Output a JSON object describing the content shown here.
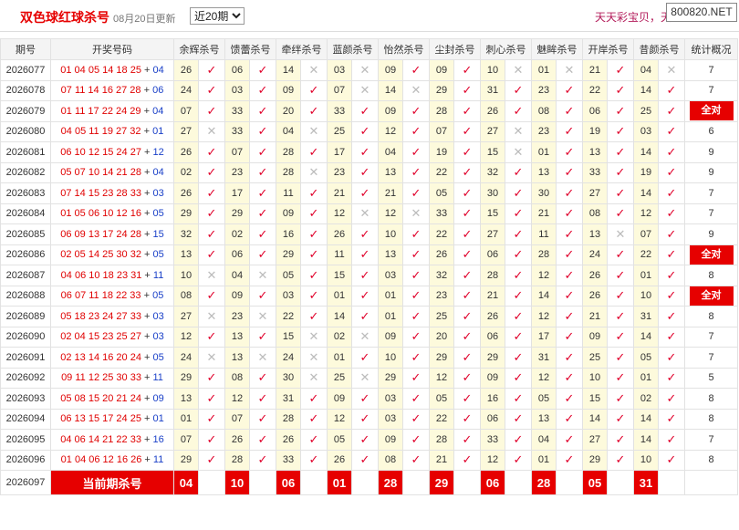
{
  "header": {
    "title": "双色球红球杀号",
    "update_text": "08月20日更新",
    "period_select": "近20期",
    "period_options": [
      "近20期"
    ],
    "slogan": "天天彩宝贝，天",
    "site_badge": "800820.NET"
  },
  "columns": [
    "期号",
    "开奖号码",
    "余辉杀号",
    "馈蕾杀号",
    "牵绊杀号",
    "蓝颜杀号",
    "怡然杀号",
    "尘封杀号",
    "刺心杀号",
    "魅眸杀号",
    "开岸杀号",
    "昔颜杀号",
    "统计概况"
  ],
  "rows": [
    {
      "period": "2026077",
      "reds": "01 04 05 14 18 25",
      "blue": "04",
      "kills": [
        [
          "26",
          "ok"
        ],
        [
          "06",
          "ok"
        ],
        [
          "14",
          "x"
        ],
        [
          "03",
          "x"
        ],
        [
          "09",
          "ok"
        ],
        [
          "09",
          "ok"
        ],
        [
          "10",
          "x"
        ],
        [
          "01",
          "x"
        ],
        [
          "21",
          "ok"
        ],
        [
          "04",
          "x"
        ]
      ],
      "stat": "7"
    },
    {
      "period": "2026078",
      "reds": "07 11 14 16 27 28",
      "blue": "06",
      "kills": [
        [
          "24",
          "ok"
        ],
        [
          "03",
          "ok"
        ],
        [
          "09",
          "ok"
        ],
        [
          "07",
          "x"
        ],
        [
          "14",
          "x"
        ],
        [
          "29",
          "ok"
        ],
        [
          "31",
          "ok"
        ],
        [
          "23",
          "ok"
        ],
        [
          "22",
          "ok"
        ],
        [
          "14",
          "ok"
        ]
      ],
      "stat": "7"
    },
    {
      "period": "2026079",
      "reds": "01 11 17 22 24 29",
      "blue": "04",
      "kills": [
        [
          "07",
          "ok"
        ],
        [
          "33",
          "ok"
        ],
        [
          "20",
          "ok"
        ],
        [
          "33",
          "ok"
        ],
        [
          "09",
          "ok"
        ],
        [
          "28",
          "ok"
        ],
        [
          "26",
          "ok"
        ],
        [
          "08",
          "ok"
        ],
        [
          "06",
          "ok"
        ],
        [
          "25",
          "ok"
        ]
      ],
      "stat": "全对"
    },
    {
      "period": "2026080",
      "reds": "04 05 11 19 27 32",
      "blue": "01",
      "kills": [
        [
          "27",
          "x"
        ],
        [
          "33",
          "ok"
        ],
        [
          "04",
          "x"
        ],
        [
          "25",
          "ok"
        ],
        [
          "12",
          "ok"
        ],
        [
          "07",
          "ok"
        ],
        [
          "27",
          "x"
        ],
        [
          "23",
          "ok"
        ],
        [
          "19",
          "ok"
        ],
        [
          "03",
          "ok"
        ]
      ],
      "stat": "6"
    },
    {
      "period": "2026081",
      "reds": "06 10 12 15 24 27",
      "blue": "12",
      "kills": [
        [
          "26",
          "ok"
        ],
        [
          "07",
          "ok"
        ],
        [
          "28",
          "ok"
        ],
        [
          "17",
          "ok"
        ],
        [
          "04",
          "ok"
        ],
        [
          "19",
          "ok"
        ],
        [
          "15",
          "x"
        ],
        [
          "01",
          "ok"
        ],
        [
          "13",
          "ok"
        ],
        [
          "14",
          "ok"
        ]
      ],
      "stat": "9"
    },
    {
      "period": "2026082",
      "reds": "05 07 10 14 21 28",
      "blue": "04",
      "kills": [
        [
          "02",
          "ok"
        ],
        [
          "23",
          "ok"
        ],
        [
          "28",
          "x"
        ],
        [
          "23",
          "ok"
        ],
        [
          "13",
          "ok"
        ],
        [
          "22",
          "ok"
        ],
        [
          "32",
          "ok"
        ],
        [
          "13",
          "ok"
        ],
        [
          "33",
          "ok"
        ],
        [
          "19",
          "ok"
        ]
      ],
      "stat": "9"
    },
    {
      "period": "2026083",
      "reds": "07 14 15 23 28 33",
      "blue": "03",
      "kills": [
        [
          "26",
          "ok"
        ],
        [
          "17",
          "ok"
        ],
        [
          "11",
          "ok"
        ],
        [
          "21",
          "ok"
        ],
        [
          "21",
          "ok"
        ],
        [
          "05",
          "ok"
        ],
        [
          "30",
          "ok"
        ],
        [
          "30",
          "ok"
        ],
        [
          "27",
          "ok"
        ],
        [
          "14",
          "ok"
        ]
      ],
      "stat": "7"
    },
    {
      "period": "2026084",
      "reds": "01 05 06 10 12 16",
      "blue": "05",
      "kills": [
        [
          "29",
          "ok"
        ],
        [
          "29",
          "ok"
        ],
        [
          "09",
          "ok"
        ],
        [
          "12",
          "x"
        ],
        [
          "12",
          "x"
        ],
        [
          "33",
          "ok"
        ],
        [
          "15",
          "ok"
        ],
        [
          "21",
          "ok"
        ],
        [
          "08",
          "ok"
        ],
        [
          "12",
          "ok"
        ]
      ],
      "stat": "7"
    },
    {
      "period": "2026085",
      "reds": "06 09 13 17 24 28",
      "blue": "15",
      "kills": [
        [
          "32",
          "ok"
        ],
        [
          "02",
          "ok"
        ],
        [
          "16",
          "ok"
        ],
        [
          "26",
          "ok"
        ],
        [
          "10",
          "ok"
        ],
        [
          "22",
          "ok"
        ],
        [
          "27",
          "ok"
        ],
        [
          "11",
          "ok"
        ],
        [
          "13",
          "x"
        ],
        [
          "07",
          "ok"
        ]
      ],
      "stat": "9"
    },
    {
      "period": "2026086",
      "reds": "02 05 14 25 30 32",
      "blue": "05",
      "kills": [
        [
          "13",
          "ok"
        ],
        [
          "06",
          "ok"
        ],
        [
          "29",
          "ok"
        ],
        [
          "11",
          "ok"
        ],
        [
          "13",
          "ok"
        ],
        [
          "26",
          "ok"
        ],
        [
          "06",
          "ok"
        ],
        [
          "28",
          "ok"
        ],
        [
          "24",
          "ok"
        ],
        [
          "22",
          "ok"
        ]
      ],
      "stat": "全对"
    },
    {
      "period": "2026087",
      "reds": "04 06 10 18 23 31",
      "blue": "11",
      "kills": [
        [
          "10",
          "x"
        ],
        [
          "04",
          "x"
        ],
        [
          "05",
          "ok"
        ],
        [
          "15",
          "ok"
        ],
        [
          "03",
          "ok"
        ],
        [
          "32",
          "ok"
        ],
        [
          "28",
          "ok"
        ],
        [
          "12",
          "ok"
        ],
        [
          "26",
          "ok"
        ],
        [
          "01",
          "ok"
        ]
      ],
      "stat": "8"
    },
    {
      "period": "2026088",
      "reds": "06 07 11 18 22 33",
      "blue": "05",
      "kills": [
        [
          "08",
          "ok"
        ],
        [
          "09",
          "ok"
        ],
        [
          "03",
          "ok"
        ],
        [
          "01",
          "ok"
        ],
        [
          "01",
          "ok"
        ],
        [
          "23",
          "ok"
        ],
        [
          "21",
          "ok"
        ],
        [
          "14",
          "ok"
        ],
        [
          "26",
          "ok"
        ],
        [
          "10",
          "ok"
        ]
      ],
      "stat": "全对"
    },
    {
      "period": "2026089",
      "reds": "05 18 23 24 27 33",
      "blue": "03",
      "kills": [
        [
          "27",
          "x"
        ],
        [
          "23",
          "x"
        ],
        [
          "22",
          "ok"
        ],
        [
          "14",
          "ok"
        ],
        [
          "01",
          "ok"
        ],
        [
          "25",
          "ok"
        ],
        [
          "26",
          "ok"
        ],
        [
          "12",
          "ok"
        ],
        [
          "21",
          "ok"
        ],
        [
          "31",
          "ok"
        ]
      ],
      "stat": "8"
    },
    {
      "period": "2026090",
      "reds": "02 04 15 23 25 27",
      "blue": "03",
      "kills": [
        [
          "12",
          "ok"
        ],
        [
          "13",
          "ok"
        ],
        [
          "15",
          "x"
        ],
        [
          "02",
          "x"
        ],
        [
          "09",
          "ok"
        ],
        [
          "20",
          "ok"
        ],
        [
          "06",
          "ok"
        ],
        [
          "17",
          "ok"
        ],
        [
          "09",
          "ok"
        ],
        [
          "14",
          "ok"
        ]
      ],
      "stat": "7"
    },
    {
      "period": "2026091",
      "reds": "02 13 14 16 20 24",
      "blue": "05",
      "kills": [
        [
          "24",
          "x"
        ],
        [
          "13",
          "x"
        ],
        [
          "24",
          "x"
        ],
        [
          "01",
          "ok"
        ],
        [
          "10",
          "ok"
        ],
        [
          "29",
          "ok"
        ],
        [
          "29",
          "ok"
        ],
        [
          "31",
          "ok"
        ],
        [
          "25",
          "ok"
        ],
        [
          "05",
          "ok"
        ]
      ],
      "stat": "7"
    },
    {
      "period": "2026092",
      "reds": "09 11 12 25 30 33",
      "blue": "11",
      "kills": [
        [
          "29",
          "ok"
        ],
        [
          "08",
          "ok"
        ],
        [
          "30",
          "x"
        ],
        [
          "25",
          "x"
        ],
        [
          "29",
          "ok"
        ],
        [
          "12",
          "ok"
        ],
        [
          "09",
          "ok"
        ],
        [
          "12",
          "ok"
        ],
        [
          "10",
          "ok"
        ],
        [
          "01",
          "ok"
        ]
      ],
      "stat": "5"
    },
    {
      "period": "2026093",
      "reds": "05 08 15 20 21 24",
      "blue": "09",
      "kills": [
        [
          "13",
          "ok"
        ],
        [
          "12",
          "ok"
        ],
        [
          "31",
          "ok"
        ],
        [
          "09",
          "ok"
        ],
        [
          "03",
          "ok"
        ],
        [
          "05",
          "ok"
        ],
        [
          "16",
          "ok"
        ],
        [
          "05",
          "ok"
        ],
        [
          "15",
          "ok"
        ],
        [
          "02",
          "ok"
        ]
      ],
      "stat": "8"
    },
    {
      "period": "2026094",
      "reds": "06 13 15 17 24 25",
      "blue": "01",
      "kills": [
        [
          "01",
          "ok"
        ],
        [
          "07",
          "ok"
        ],
        [
          "28",
          "ok"
        ],
        [
          "12",
          "ok"
        ],
        [
          "03",
          "ok"
        ],
        [
          "22",
          "ok"
        ],
        [
          "06",
          "ok"
        ],
        [
          "13",
          "ok"
        ],
        [
          "14",
          "ok"
        ],
        [
          "14",
          "ok"
        ]
      ],
      "stat": "8"
    },
    {
      "period": "2026095",
      "reds": "04 06 14 21 22 33",
      "blue": "16",
      "kills": [
        [
          "07",
          "ok"
        ],
        [
          "26",
          "ok"
        ],
        [
          "26",
          "ok"
        ],
        [
          "05",
          "ok"
        ],
        [
          "09",
          "ok"
        ],
        [
          "28",
          "ok"
        ],
        [
          "33",
          "ok"
        ],
        [
          "04",
          "ok"
        ],
        [
          "27",
          "ok"
        ],
        [
          "14",
          "ok"
        ]
      ],
      "stat": "7"
    },
    {
      "period": "2026096",
      "reds": "01 04 06 12 16 26",
      "blue": "11",
      "kills": [
        [
          "29",
          "ok"
        ],
        [
          "28",
          "ok"
        ],
        [
          "33",
          "ok"
        ],
        [
          "26",
          "ok"
        ],
        [
          "08",
          "ok"
        ],
        [
          "21",
          "ok"
        ],
        [
          "12",
          "ok"
        ],
        [
          "01",
          "ok"
        ],
        [
          "29",
          "ok"
        ],
        [
          "10",
          "ok"
        ]
      ],
      "stat": "8"
    }
  ],
  "current": {
    "period": "2026097",
    "label": "当前期杀号",
    "kills": [
      "04",
      "10",
      "06",
      "01",
      "28",
      "29",
      "06",
      "28",
      "05",
      "31"
    ]
  }
}
